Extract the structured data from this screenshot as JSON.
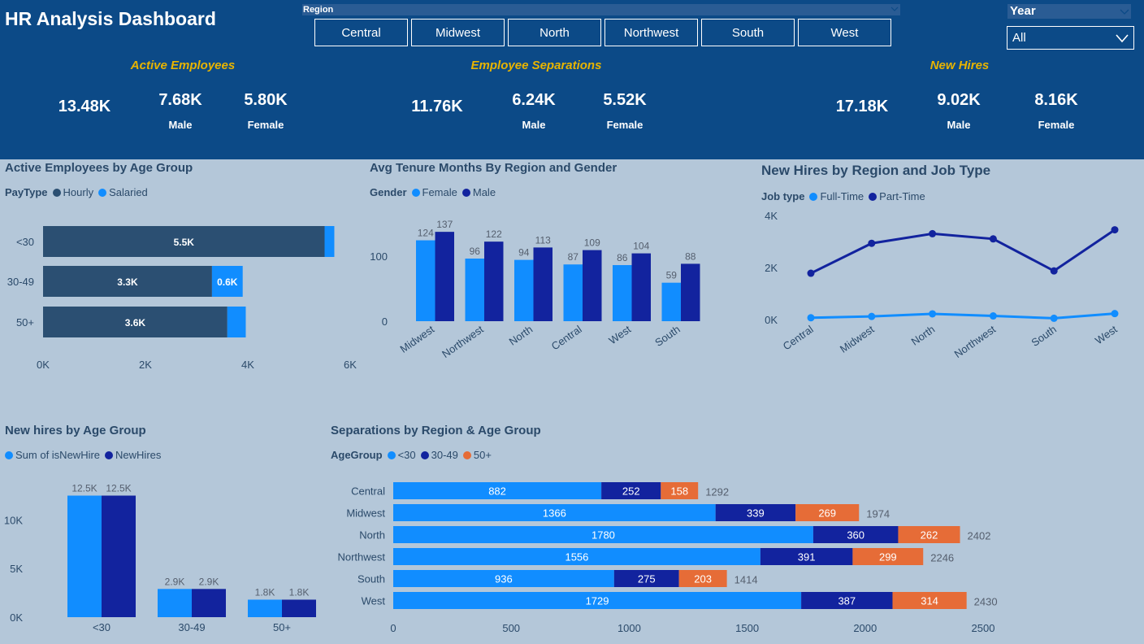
{
  "title": "HR Analysis Dashboard",
  "region_filter": {
    "label": "Region",
    "options": [
      "Central",
      "Midwest",
      "North",
      "Northwest",
      "South",
      "West"
    ]
  },
  "year_filter": {
    "label": "Year",
    "value": "All"
  },
  "kpis": [
    {
      "title": "Active Employees",
      "total": "13.48K",
      "male": "7.68K",
      "male_label": "Male",
      "female": "5.80K",
      "female_label": "Female"
    },
    {
      "title": "Employee Separations",
      "total": "11.76K",
      "male": "6.24K",
      "male_label": "Male",
      "female": "5.52K",
      "female_label": "Female"
    },
    {
      "title": "New Hires",
      "total": "17.18K",
      "male": "9.02K",
      "male_label": "Male",
      "female": "8.16K",
      "female_label": "Female"
    }
  ],
  "colors": {
    "header_bg": "#0c4a87",
    "page_bg": "#b4c7d9",
    "kpi_title": "#e8b400",
    "light_blue": "#118dff",
    "dark_navy": "#12239e",
    "slate": "#2b4f72",
    "orange": "#e66c37"
  },
  "chart_data": [
    {
      "id": "active_by_age",
      "type": "bar",
      "orientation": "horizontal",
      "stacked": true,
      "title": "Active Employees by Age Group",
      "legend_title": "PayType",
      "categories": [
        "<30",
        "30-49",
        "50+"
      ],
      "series": [
        {
          "name": "Hourly",
          "values": [
            5500,
            3300,
            3600
          ],
          "labels": [
            "5.5K",
            "3.3K",
            "3.6K"
          ],
          "color": "#2b4f72"
        },
        {
          "name": "Salaried",
          "values": [
            190,
            600,
            360
          ],
          "labels": [
            "",
            "0.6K",
            ""
          ],
          "color": "#118dff"
        }
      ],
      "xlim": [
        0,
        6000
      ],
      "x_ticks": [
        "0K",
        "2K",
        "4K",
        "6K"
      ]
    },
    {
      "id": "avg_tenure",
      "type": "bar",
      "title": "Avg Tenure Months By Region and Gender",
      "legend_title": "Gender",
      "categories": [
        "Midwest",
        "Northwest",
        "North",
        "Central",
        "West",
        "South"
      ],
      "series": [
        {
          "name": "Female",
          "values": [
            124,
            96,
            94,
            87,
            86,
            59
          ],
          "color": "#118dff"
        },
        {
          "name": "Male",
          "values": [
            137,
            122,
            113,
            109,
            104,
            88
          ],
          "color": "#12239e"
        }
      ],
      "ylim": [
        0,
        150
      ],
      "y_ticks": [
        "0",
        "100"
      ]
    },
    {
      "id": "new_hires_job",
      "type": "line",
      "title": "New Hires by Region and Job Type",
      "legend_title": "Job type",
      "categories": [
        "Central",
        "Midwest",
        "North",
        "Northwest",
        "South",
        "West"
      ],
      "series": [
        {
          "name": "Full-Time",
          "values": [
            70,
            120,
            220,
            140,
            50,
            230
          ],
          "color": "#118dff"
        },
        {
          "name": "Part-Time",
          "values": [
            1780,
            2930,
            3300,
            3100,
            1870,
            3450
          ],
          "color": "#12239e"
        }
      ],
      "ylim": [
        0,
        4000
      ],
      "y_ticks": [
        "0K",
        "2K",
        "4K"
      ]
    },
    {
      "id": "new_hires_age",
      "type": "bar",
      "title": "New hires by Age Group",
      "categories": [
        "<30",
        "30-49",
        "50+"
      ],
      "series": [
        {
          "name": "Sum of isNewHire",
          "values": [
            12500,
            2900,
            1800
          ],
          "labels": [
            "12.5K",
            "2.9K",
            "1.8K"
          ],
          "color": "#118dff"
        },
        {
          "name": "NewHires",
          "values": [
            12500,
            2900,
            1800
          ],
          "labels": [
            "12.5K",
            "2.9K",
            "1.8K"
          ],
          "color": "#12239e"
        }
      ],
      "ylim": [
        0,
        15000
      ],
      "y_ticks": [
        "0K",
        "5K",
        "10K"
      ]
    },
    {
      "id": "separations",
      "type": "bar",
      "orientation": "horizontal",
      "stacked": true,
      "title": "Separations by Region & Age Group",
      "legend_title": "AgeGroup",
      "categories": [
        "Central",
        "Midwest",
        "North",
        "Northwest",
        "South",
        "West"
      ],
      "series": [
        {
          "name": "<30",
          "values": [
            882,
            1366,
            1780,
            1556,
            936,
            1729
          ],
          "color": "#118dff"
        },
        {
          "name": "30-49",
          "values": [
            252,
            339,
            360,
            391,
            275,
            387
          ],
          "color": "#12239e"
        },
        {
          "name": "50+",
          "values": [
            158,
            269,
            262,
            299,
            203,
            314
          ],
          "color": "#e66c37"
        }
      ],
      "totals": [
        1292,
        1974,
        2402,
        2246,
        1414,
        2430
      ],
      "xlim": [
        0,
        2500
      ],
      "x_ticks": [
        "0",
        "500",
        "1000",
        "1500",
        "2000",
        "2500"
      ]
    }
  ]
}
